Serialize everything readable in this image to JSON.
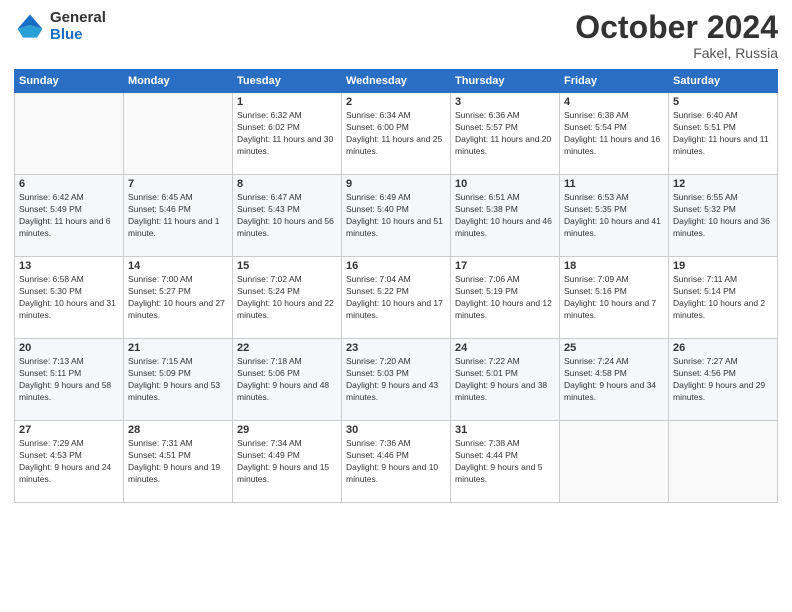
{
  "logo": {
    "general": "General",
    "blue": "Blue"
  },
  "header": {
    "month": "October 2024",
    "location": "Fakel, Russia"
  },
  "weekdays": [
    "Sunday",
    "Monday",
    "Tuesday",
    "Wednesday",
    "Thursday",
    "Friday",
    "Saturday"
  ],
  "weeks": [
    [
      {
        "day": "",
        "sunrise": "",
        "sunset": "",
        "daylight": ""
      },
      {
        "day": "",
        "sunrise": "",
        "sunset": "",
        "daylight": ""
      },
      {
        "day": "1",
        "sunrise": "Sunrise: 6:32 AM",
        "sunset": "Sunset: 6:02 PM",
        "daylight": "Daylight: 11 hours and 30 minutes."
      },
      {
        "day": "2",
        "sunrise": "Sunrise: 6:34 AM",
        "sunset": "Sunset: 6:00 PM",
        "daylight": "Daylight: 11 hours and 25 minutes."
      },
      {
        "day": "3",
        "sunrise": "Sunrise: 6:36 AM",
        "sunset": "Sunset: 5:57 PM",
        "daylight": "Daylight: 11 hours and 20 minutes."
      },
      {
        "day": "4",
        "sunrise": "Sunrise: 6:38 AM",
        "sunset": "Sunset: 5:54 PM",
        "daylight": "Daylight: 11 hours and 16 minutes."
      },
      {
        "day": "5",
        "sunrise": "Sunrise: 6:40 AM",
        "sunset": "Sunset: 5:51 PM",
        "daylight": "Daylight: 11 hours and 11 minutes."
      }
    ],
    [
      {
        "day": "6",
        "sunrise": "Sunrise: 6:42 AM",
        "sunset": "Sunset: 5:49 PM",
        "daylight": "Daylight: 11 hours and 6 minutes."
      },
      {
        "day": "7",
        "sunrise": "Sunrise: 6:45 AM",
        "sunset": "Sunset: 5:46 PM",
        "daylight": "Daylight: 11 hours and 1 minute."
      },
      {
        "day": "8",
        "sunrise": "Sunrise: 6:47 AM",
        "sunset": "Sunset: 5:43 PM",
        "daylight": "Daylight: 10 hours and 56 minutes."
      },
      {
        "day": "9",
        "sunrise": "Sunrise: 6:49 AM",
        "sunset": "Sunset: 5:40 PM",
        "daylight": "Daylight: 10 hours and 51 minutes."
      },
      {
        "day": "10",
        "sunrise": "Sunrise: 6:51 AM",
        "sunset": "Sunset: 5:38 PM",
        "daylight": "Daylight: 10 hours and 46 minutes."
      },
      {
        "day": "11",
        "sunrise": "Sunrise: 6:53 AM",
        "sunset": "Sunset: 5:35 PM",
        "daylight": "Daylight: 10 hours and 41 minutes."
      },
      {
        "day": "12",
        "sunrise": "Sunrise: 6:55 AM",
        "sunset": "Sunset: 5:32 PM",
        "daylight": "Daylight: 10 hours and 36 minutes."
      }
    ],
    [
      {
        "day": "13",
        "sunrise": "Sunrise: 6:58 AM",
        "sunset": "Sunset: 5:30 PM",
        "daylight": "Daylight: 10 hours and 31 minutes."
      },
      {
        "day": "14",
        "sunrise": "Sunrise: 7:00 AM",
        "sunset": "Sunset: 5:27 PM",
        "daylight": "Daylight: 10 hours and 27 minutes."
      },
      {
        "day": "15",
        "sunrise": "Sunrise: 7:02 AM",
        "sunset": "Sunset: 5:24 PM",
        "daylight": "Daylight: 10 hours and 22 minutes."
      },
      {
        "day": "16",
        "sunrise": "Sunrise: 7:04 AM",
        "sunset": "Sunset: 5:22 PM",
        "daylight": "Daylight: 10 hours and 17 minutes."
      },
      {
        "day": "17",
        "sunrise": "Sunrise: 7:06 AM",
        "sunset": "Sunset: 5:19 PM",
        "daylight": "Daylight: 10 hours and 12 minutes."
      },
      {
        "day": "18",
        "sunrise": "Sunrise: 7:09 AM",
        "sunset": "Sunset: 5:16 PM",
        "daylight": "Daylight: 10 hours and 7 minutes."
      },
      {
        "day": "19",
        "sunrise": "Sunrise: 7:11 AM",
        "sunset": "Sunset: 5:14 PM",
        "daylight": "Daylight: 10 hours and 2 minutes."
      }
    ],
    [
      {
        "day": "20",
        "sunrise": "Sunrise: 7:13 AM",
        "sunset": "Sunset: 5:11 PM",
        "daylight": "Daylight: 9 hours and 58 minutes."
      },
      {
        "day": "21",
        "sunrise": "Sunrise: 7:15 AM",
        "sunset": "Sunset: 5:09 PM",
        "daylight": "Daylight: 9 hours and 53 minutes."
      },
      {
        "day": "22",
        "sunrise": "Sunrise: 7:18 AM",
        "sunset": "Sunset: 5:06 PM",
        "daylight": "Daylight: 9 hours and 48 minutes."
      },
      {
        "day": "23",
        "sunrise": "Sunrise: 7:20 AM",
        "sunset": "Sunset: 5:03 PM",
        "daylight": "Daylight: 9 hours and 43 minutes."
      },
      {
        "day": "24",
        "sunrise": "Sunrise: 7:22 AM",
        "sunset": "Sunset: 5:01 PM",
        "daylight": "Daylight: 9 hours and 38 minutes."
      },
      {
        "day": "25",
        "sunrise": "Sunrise: 7:24 AM",
        "sunset": "Sunset: 4:58 PM",
        "daylight": "Daylight: 9 hours and 34 minutes."
      },
      {
        "day": "26",
        "sunrise": "Sunrise: 7:27 AM",
        "sunset": "Sunset: 4:56 PM",
        "daylight": "Daylight: 9 hours and 29 minutes."
      }
    ],
    [
      {
        "day": "27",
        "sunrise": "Sunrise: 7:29 AM",
        "sunset": "Sunset: 4:53 PM",
        "daylight": "Daylight: 9 hours and 24 minutes."
      },
      {
        "day": "28",
        "sunrise": "Sunrise: 7:31 AM",
        "sunset": "Sunset: 4:51 PM",
        "daylight": "Daylight: 9 hours and 19 minutes."
      },
      {
        "day": "29",
        "sunrise": "Sunrise: 7:34 AM",
        "sunset": "Sunset: 4:49 PM",
        "daylight": "Daylight: 9 hours and 15 minutes."
      },
      {
        "day": "30",
        "sunrise": "Sunrise: 7:36 AM",
        "sunset": "Sunset: 4:46 PM",
        "daylight": "Daylight: 9 hours and 10 minutes."
      },
      {
        "day": "31",
        "sunrise": "Sunrise: 7:38 AM",
        "sunset": "Sunset: 4:44 PM",
        "daylight": "Daylight: 9 hours and 5 minutes."
      },
      {
        "day": "",
        "sunrise": "",
        "sunset": "",
        "daylight": ""
      },
      {
        "day": "",
        "sunrise": "",
        "sunset": "",
        "daylight": ""
      }
    ]
  ]
}
